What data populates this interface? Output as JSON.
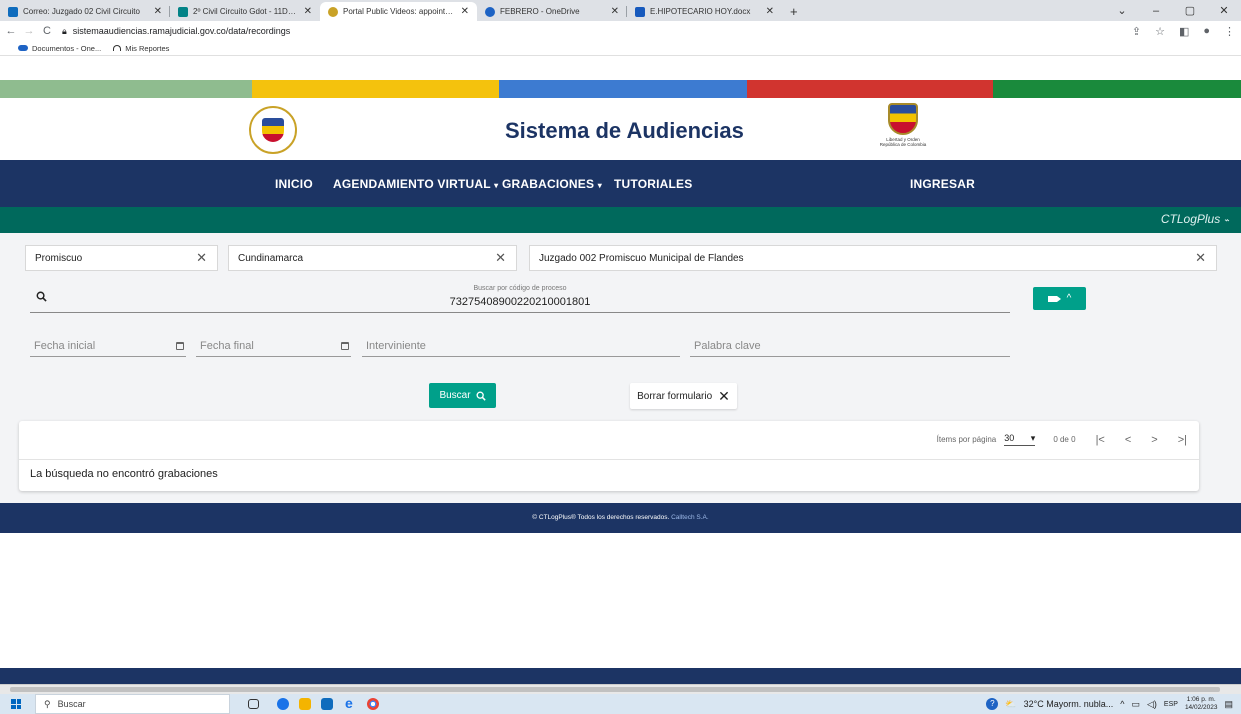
{
  "browser": {
    "tabs": [
      {
        "title": "Correo: Juzgado 02 Civil Circuito",
        "favicon_color": "#0f6cbd",
        "active": false
      },
      {
        "title": "2º Civil Circuito Gdot - 11Devolu",
        "favicon_color": "#038387",
        "active": false
      },
      {
        "title": "Portal Public Videos: appointmen",
        "favicon_color": "#c9a227",
        "active": true
      },
      {
        "title": "FEBRERO - OneDrive",
        "favicon_color": "#1e63c4",
        "active": false
      },
      {
        "title": "E.HIPOTECARIO HOY.docx",
        "favicon_color": "#185abd",
        "active": false
      }
    ],
    "url": "sistemaaudiencias.ramajudicial.gov.co/data/recordings",
    "bookmarks": [
      "Documentos - One...",
      "Mis Reportes"
    ]
  },
  "colors": {
    "flag": [
      "#8fbc8f",
      "#f4c20d",
      "#3d7bd1",
      "#d1342f",
      "#1a8a3c"
    ],
    "navy": "#1c3464",
    "teal": "#00695c",
    "accent": "#00a08a"
  },
  "header": {
    "title": "Sistema de Audiencias",
    "seal_caption": "Libertad y Orden\nRepública de Colombia"
  },
  "nav": {
    "items": [
      "INICIO",
      "AGENDAMIENTO VIRTUAL",
      "GRABACIONES",
      "TUTORIALES"
    ],
    "login": "INGRESAR",
    "brand": "CTLogPlus"
  },
  "filters": {
    "especialidad": "Promiscuo",
    "departamento": "Cundinamarca",
    "despacho": "Juzgado 002 Promiscuo Municipal de Flandes",
    "search_label": "Buscar por código de proceso",
    "search_value": "73275408900220210001801",
    "fecha_inicial": "Fecha inicial",
    "fecha_final": "Fecha final",
    "interviniente": "Interviniente",
    "palabra_clave": "Palabra clave"
  },
  "buttons": {
    "buscar": "Buscar",
    "borrar": "Borrar formulario"
  },
  "results": {
    "items_per_page_label": "Ítems por página",
    "items_per_page": "30",
    "range": "0 de 0",
    "empty_message": "La búsqueda no encontró grabaciones"
  },
  "footer": {
    "text": "© CTLogPlus® Todos los derechos reservados.",
    "company": "Calltech S.A."
  },
  "taskbar": {
    "search": "Buscar",
    "weather": "32°C  Mayorm. nubla...",
    "lang": "ESP",
    "time": "1:06 p. m.",
    "date": "14/02/2023"
  }
}
